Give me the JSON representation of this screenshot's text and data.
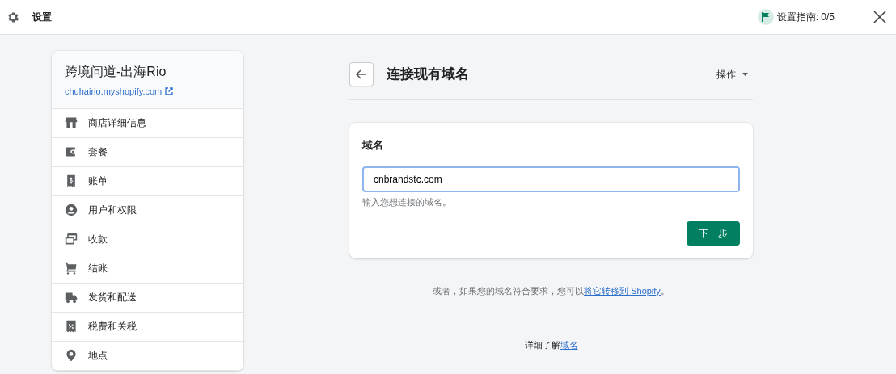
{
  "topbar": {
    "title": "设置",
    "setup_guide": "设置指南: 0/5"
  },
  "store": {
    "name": "跨境问道-出海Rio",
    "url": "chuhairio.myshopify.com"
  },
  "sidebar": {
    "items": [
      {
        "label": "商店详细信息"
      },
      {
        "label": "套餐"
      },
      {
        "label": "账单"
      },
      {
        "label": "用户和权限"
      },
      {
        "label": "收款"
      },
      {
        "label": "结账"
      },
      {
        "label": "发货和配送"
      },
      {
        "label": "税费和关税"
      },
      {
        "label": "地点"
      }
    ]
  },
  "page": {
    "title": "连接现有域名",
    "actions": "操作"
  },
  "domain_card": {
    "label": "域名",
    "value": "cnbrandstc.com",
    "focused": true,
    "help": "输入您想连接的域名。",
    "button": "下一步"
  },
  "transfer_note": {
    "text": "或者，如果您的域名符合要求，您可以",
    "link": "将它转移到 Shopify",
    "after": "。"
  },
  "learn_more": {
    "text": "详细了解",
    "link": "域名"
  }
}
